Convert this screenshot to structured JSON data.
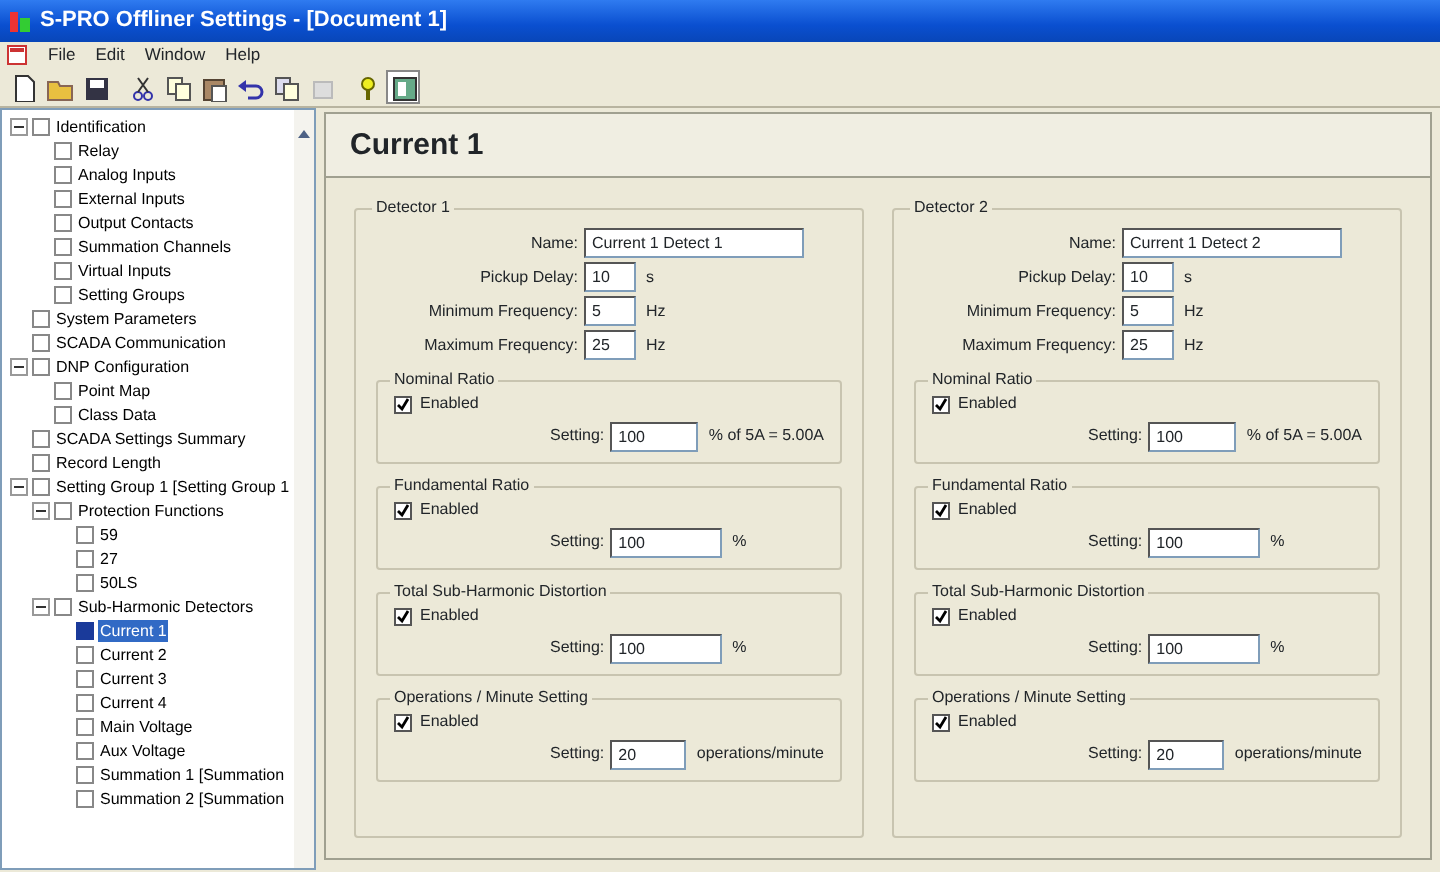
{
  "window": {
    "title": "S-PRO Offliner Settings - [Document 1]"
  },
  "menu": [
    "File",
    "Edit",
    "Window",
    "Help"
  ],
  "tree": [
    {
      "label": "Identification",
      "expanded": true,
      "selected": false,
      "children": [
        {
          "label": "Relay",
          "selected": false
        },
        {
          "label": "Analog Inputs",
          "selected": false
        },
        {
          "label": "External Inputs",
          "selected": false
        },
        {
          "label": "Output Contacts",
          "selected": false
        },
        {
          "label": "Summation Channels",
          "selected": false
        },
        {
          "label": "Virtual Inputs",
          "selected": false
        },
        {
          "label": "Setting Groups",
          "selected": false
        }
      ]
    },
    {
      "label": "System Parameters",
      "selected": false
    },
    {
      "label": "SCADA Communication",
      "selected": false
    },
    {
      "label": "DNP Configuration",
      "expanded": true,
      "selected": false,
      "children": [
        {
          "label": "Point Map",
          "selected": false
        },
        {
          "label": "Class Data",
          "selected": false
        }
      ]
    },
    {
      "label": "SCADA Settings Summary",
      "selected": false
    },
    {
      "label": "Record Length",
      "selected": false
    },
    {
      "label": "Setting Group 1 [Setting Group 1",
      "expanded": true,
      "selected": false,
      "children": [
        {
          "label": "Protection Functions",
          "expanded": true,
          "selected": false,
          "children": [
            {
              "label": "59",
              "selected": false
            },
            {
              "label": "27",
              "selected": false
            },
            {
              "label": "50LS",
              "selected": false
            }
          ]
        },
        {
          "label": "Sub-Harmonic Detectors",
          "expanded": true,
          "selected": false,
          "children": [
            {
              "label": "Current 1",
              "selected": true
            },
            {
              "label": "Current 2",
              "selected": false
            },
            {
              "label": "Current 3",
              "selected": false
            },
            {
              "label": "Current 4",
              "selected": false
            },
            {
              "label": "Main Voltage",
              "selected": false
            },
            {
              "label": "Aux Voltage",
              "selected": false
            },
            {
              "label": "Summation 1 [Summation",
              "selected": false
            },
            {
              "label": "Summation 2 [Summation",
              "selected": false
            }
          ]
        }
      ]
    }
  ],
  "page": {
    "title": "Current 1",
    "detectors": [
      {
        "title": "Detector 1",
        "fields": [
          {
            "label": "Name:",
            "value": "Current 1 Detect 1",
            "kind": "wide"
          },
          {
            "label": "Pickup Delay:",
            "value": "10",
            "unit": "s",
            "kind": "short"
          },
          {
            "label": "Minimum Frequency:",
            "value": "5",
            "unit": "Hz",
            "kind": "short"
          },
          {
            "label": "Maximum Frequency:",
            "value": "25",
            "unit": "Hz",
            "kind": "short"
          }
        ],
        "groups": [
          {
            "title": "Nominal Ratio",
            "check_label": "Enabled",
            "enabled": true,
            "setting_label": "Setting:",
            "value": "100",
            "unit": "% of 5A = 5.00A"
          },
          {
            "title": "Fundamental Ratio",
            "check_label": "Enabled",
            "enabled": true,
            "setting_label": "Setting:",
            "value": "100",
            "unit": "%"
          },
          {
            "title": "Total Sub-Harmonic Distortion",
            "check_label": "Enabled",
            "enabled": true,
            "setting_label": "Setting:",
            "value": "100",
            "unit": "%"
          },
          {
            "title": "Operations / Minute Setting",
            "check_label": "Enabled",
            "enabled": true,
            "setting_label": "Setting:",
            "value": "20",
            "unit": "operations/minute"
          }
        ]
      },
      {
        "title": "Detector 2",
        "fields": [
          {
            "label": "Name:",
            "value": "Current 1 Detect 2",
            "kind": "wide"
          },
          {
            "label": "Pickup Delay:",
            "value": "10",
            "unit": "s",
            "kind": "short"
          },
          {
            "label": "Minimum Frequency:",
            "value": "5",
            "unit": "Hz",
            "kind": "short"
          },
          {
            "label": "Maximum Frequency:",
            "value": "25",
            "unit": "Hz",
            "kind": "short"
          }
        ],
        "groups": [
          {
            "title": "Nominal Ratio",
            "check_label": "Enabled",
            "enabled": true,
            "setting_label": "Setting:",
            "value": "100",
            "unit": "% of 5A = 5.00A"
          },
          {
            "title": "Fundamental Ratio",
            "check_label": "Enabled",
            "enabled": true,
            "setting_label": "Setting:",
            "value": "100",
            "unit": "%"
          },
          {
            "title": "Total Sub-Harmonic Distortion",
            "check_label": "Enabled",
            "enabled": true,
            "setting_label": "Setting:",
            "value": "100",
            "unit": "%"
          },
          {
            "title": "Operations / Minute Setting",
            "check_label": "Enabled",
            "enabled": true,
            "setting_label": "Setting:",
            "value": "20",
            "unit": "operations/minute"
          }
        ]
      }
    ]
  }
}
